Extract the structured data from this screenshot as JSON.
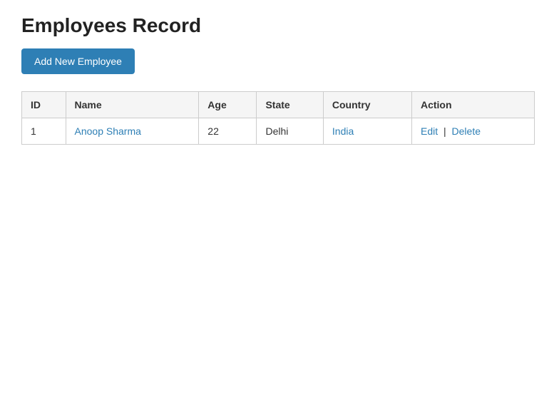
{
  "page": {
    "title": "Employees Record",
    "add_button_label": "Add New Employee"
  },
  "table": {
    "columns": [
      {
        "key": "id",
        "label": "ID"
      },
      {
        "key": "name",
        "label": "Name"
      },
      {
        "key": "age",
        "label": "Age"
      },
      {
        "key": "state",
        "label": "State"
      },
      {
        "key": "country",
        "label": "Country"
      },
      {
        "key": "action",
        "label": "Action"
      }
    ],
    "rows": [
      {
        "id": "1",
        "name": "Anoop Sharma",
        "age": "22",
        "state": "Delhi",
        "country": "India",
        "edit_label": "Edit",
        "delete_label": "Delete",
        "separator": "|"
      }
    ]
  }
}
